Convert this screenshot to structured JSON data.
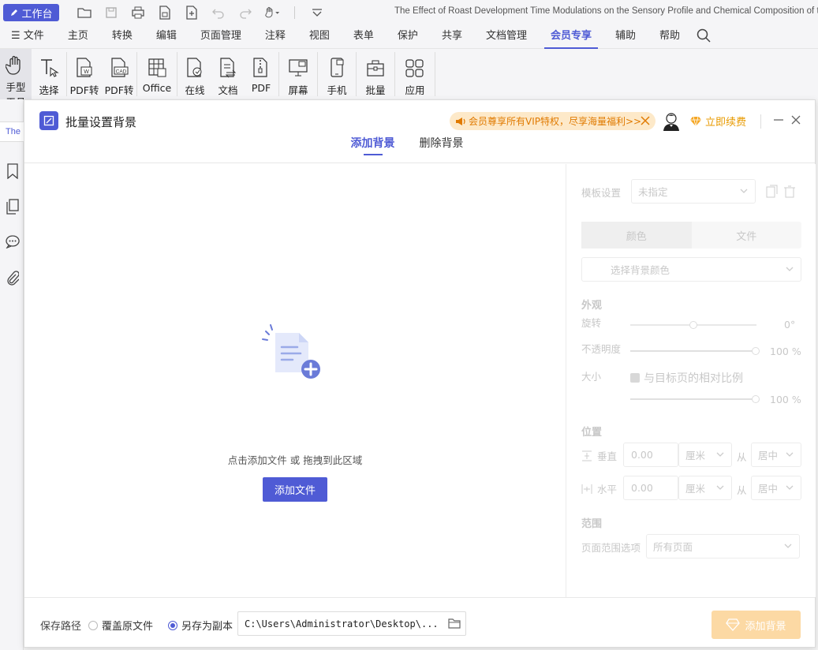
{
  "titlebar": {
    "workbench_label": "工作台",
    "doc_title": "The Effect of Roast Development Time Modulations on the Sensory Profile and Chemical Composition of t"
  },
  "menubar": {
    "items": [
      "文件",
      "主页",
      "转换",
      "编辑",
      "页面管理",
      "注释",
      "视图",
      "表单",
      "保护",
      "共享",
      "文档管理",
      "会员专享",
      "辅助",
      "帮助"
    ],
    "active": "会员专享"
  },
  "ribbon": {
    "tools": [
      {
        "label": "手型",
        "label2": "工具",
        "icon": "hand-icon"
      },
      {
        "label": "选择",
        "icon": "select-text-icon"
      },
      {
        "label": "PDF转",
        "icon": "pdf-to-word-icon"
      },
      {
        "label": "PDF转",
        "icon": "pdf-to-cad-icon"
      },
      {
        "label": "Office",
        "icon": "office-icon"
      },
      {
        "label": "在线",
        "icon": "online-icon"
      },
      {
        "label": "文档",
        "icon": "doc-compare-icon"
      },
      {
        "label": "PDF",
        "icon": "pdf-zip-icon"
      },
      {
        "label": "屏幕",
        "icon": "screen-icon"
      },
      {
        "label": "手机",
        "icon": "phone-icon"
      },
      {
        "label": "批量",
        "icon": "batch-icon"
      },
      {
        "label": "应用",
        "icon": "apps-icon"
      }
    ]
  },
  "leftbar": {
    "tab_text": "The"
  },
  "dialog": {
    "title": "批量设置背景",
    "vip_banner": "会员尊享所有VIP特权，尽享海量福利>>",
    "renew_label": "立即续费",
    "tabs": [
      "添加背景",
      "删除背景"
    ],
    "active_tab": "添加背景",
    "drop_hint": "点击添加文件 或 拖拽到此区域",
    "add_file_button": "添加文件"
  },
  "settings": {
    "template_label": "模板设置",
    "template_value": "未指定",
    "seg_color": "颜色",
    "seg_file": "文件",
    "color_placeholder": "选择背景颜色",
    "appearance_title": "外观",
    "rotation_label": "旋转",
    "rotation_value": "0°",
    "opacity_label": "不透明度",
    "opacity_value": "100 %",
    "size_label": "大小",
    "relative_scale_label": "与目标页的相对比例",
    "scale_value": "100 %",
    "position_title": "位置",
    "vertical_label": "垂直",
    "vertical_value": "0.00",
    "vertical_unit": "厘米",
    "from_label": "从",
    "vertical_from": "居中",
    "horizontal_label": "水平",
    "horizontal_value": "0.00",
    "horizontal_unit": "厘米",
    "horizontal_from": "居中",
    "range_title": "范围",
    "page_range_label": "页面范围选项",
    "page_range_value": "所有页面"
  },
  "footer": {
    "save_path_label": "保存路径",
    "overwrite_label": "覆盖原文件",
    "save_copy_label": "另存为副本",
    "path_value": "C:\\Users\\Administrator\\Desktop\\...",
    "apply_button": "添加背景"
  },
  "colors": {
    "accent": "#4f5bd5",
    "vip_bg": "#fde9c9",
    "vip_text": "#e07a00",
    "apply_btn": "#fcd9a4"
  }
}
